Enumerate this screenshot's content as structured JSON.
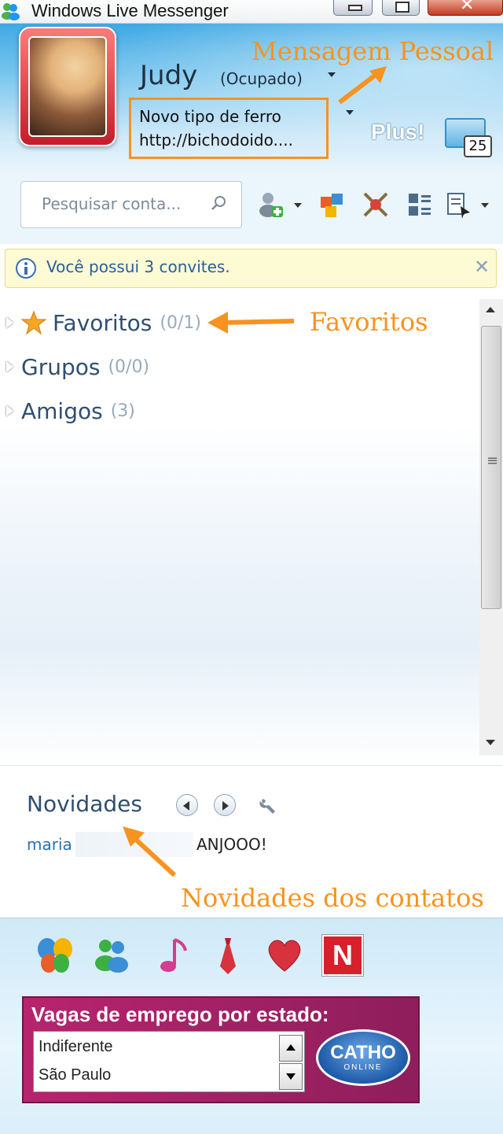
{
  "window": {
    "title": "Windows Live Messenger",
    "close_glyph": "✕"
  },
  "profile": {
    "name": "Judy",
    "status": "(Ocupado)",
    "personal_message_line1": "Novo tipo de ferro",
    "personal_message_line2": "http://bichodoido....",
    "plus_label": "Plus!",
    "calendar_badge": "25"
  },
  "search": {
    "placeholder": "Pesquisar conta..."
  },
  "toolbar": {
    "icons": [
      "add-contact-icon",
      "games-icon",
      "activities-icon",
      "layout-icon",
      "show-menu-icon"
    ]
  },
  "invite": {
    "text": "Você possui 3 convites.",
    "close": "✕"
  },
  "groups": [
    {
      "name": "Favoritos",
      "count": "(0/1)"
    },
    {
      "name": "Grupos",
      "count": "(0/0)"
    },
    {
      "name": "Amigos",
      "count": "(3)"
    }
  ],
  "news": {
    "heading": "Novidades",
    "contact": "maria",
    "message": "ANJOOO!"
  },
  "annotations": {
    "personal_message": "Mensagem Pessoal",
    "favorites": "Favoritos",
    "news": "Novidades dos contatos"
  },
  "apps": [
    "msn-butterfly-icon",
    "messenger-people-icon",
    "music-note-icon",
    "tie-icon",
    "heart-icon",
    "netflix-icon"
  ],
  "netflix_letter": "N",
  "ad": {
    "title": "Vagas de emprego por estado:",
    "options": [
      "Indiferente",
      "São Paulo"
    ],
    "logo_line1": "CATHO",
    "logo_line2": "ONLINE"
  },
  "colors": {
    "annotation": "#f7931e",
    "header_blue": "#3fa9e4",
    "ad_magenta": "#b8246e"
  }
}
